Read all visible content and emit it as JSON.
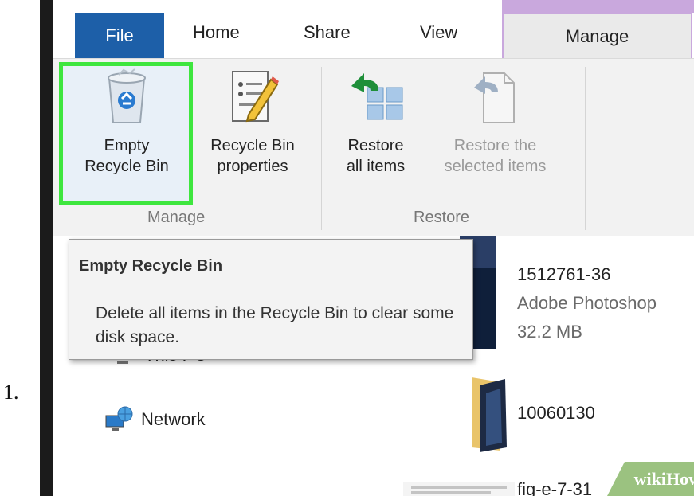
{
  "step_number": "1.",
  "tabs": {
    "file": "File",
    "home": "Home",
    "share": "Share",
    "view": "View",
    "manage": "Manage"
  },
  "ribbon": {
    "manage_group": {
      "label": "Manage",
      "empty_bin": {
        "line1": "Empty",
        "line2": "Recycle Bin",
        "icon": "recycle-bin-icon"
      },
      "bin_properties": {
        "line1": "Recycle Bin",
        "line2": "properties",
        "icon": "properties-icon"
      }
    },
    "restore_group": {
      "label": "Restore",
      "restore_all": {
        "line1": "Restore",
        "line2": "all items",
        "icon": "restore-all-icon"
      },
      "restore_selected": {
        "line1": "Restore the",
        "line2": "selected items",
        "icon": "restore-selected-icon"
      }
    }
  },
  "tooltip": {
    "title": "Empty Recycle Bin",
    "body": "Delete all items in the Recycle Bin to clear some disk space."
  },
  "nav": {
    "this_pc": "This PC",
    "network": "Network"
  },
  "files": [
    {
      "name": "1512761-36",
      "type": "Adobe Photoshop",
      "size": "32.2 MB"
    },
    {
      "name": "10060130"
    },
    {
      "name": "fig-e-7-31"
    }
  ],
  "watermark": "wikiHow",
  "colors": {
    "highlight": "#3ee63e",
    "file_tab": "#1d5fa8",
    "manage_accent": "#c9a8dd"
  }
}
